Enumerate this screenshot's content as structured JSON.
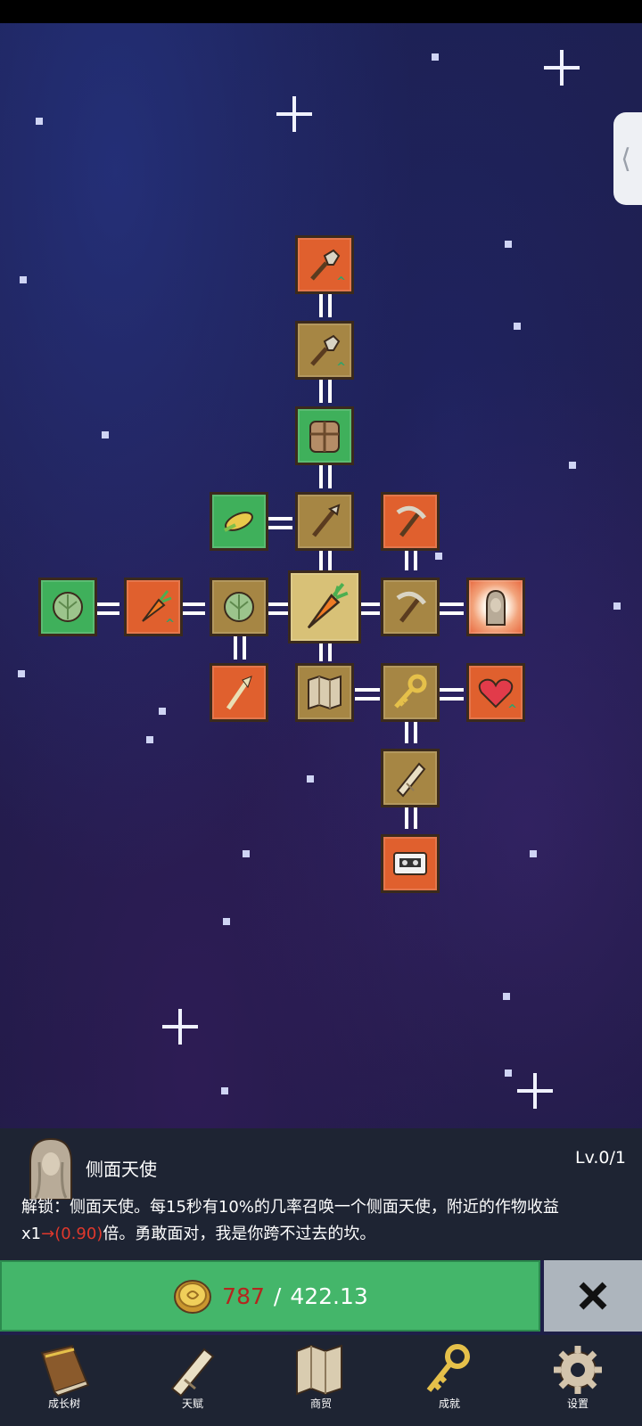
{
  "side_tab": {
    "glyph": "⟨"
  },
  "tree": {
    "nodes": [
      {
        "id": "shovel-upgrade",
        "icon": "shovel-icon",
        "color": "orange",
        "upgraded": true
      },
      {
        "id": "shovel",
        "icon": "shovel-icon",
        "color": "brown",
        "upgraded": true
      },
      {
        "id": "backpack",
        "icon": "backpack-icon",
        "color": "green",
        "upgraded": false
      },
      {
        "id": "corn",
        "icon": "corn-icon",
        "color": "green",
        "upgraded": false
      },
      {
        "id": "hoe",
        "icon": "hoe-icon",
        "color": "brown",
        "upgraded": false
      },
      {
        "id": "pickaxe-upgrade",
        "icon": "pickaxe-icon",
        "color": "orange",
        "upgraded": false
      },
      {
        "id": "cabbage-far",
        "icon": "cabbage-icon",
        "color": "green",
        "upgraded": false
      },
      {
        "id": "carrot-upgrade",
        "icon": "carrot-icon",
        "color": "orange",
        "upgraded": true
      },
      {
        "id": "cabbage",
        "icon": "cabbage-icon",
        "color": "brown",
        "upgraded": false
      },
      {
        "id": "carrot-root",
        "icon": "carrot-icon",
        "color": "center",
        "upgraded": false
      },
      {
        "id": "pickaxe",
        "icon": "pickaxe-icon",
        "color": "brown",
        "upgraded": false
      },
      {
        "id": "side-angel",
        "icon": "angel-icon",
        "color": "selected",
        "upgraded": false
      },
      {
        "id": "wheat",
        "icon": "wheat-icon",
        "color": "orange",
        "upgraded": false
      },
      {
        "id": "map",
        "icon": "map-icon",
        "color": "brown",
        "upgraded": false
      },
      {
        "id": "key",
        "icon": "key-icon",
        "color": "brown",
        "upgraded": false
      },
      {
        "id": "heart",
        "icon": "heart-icon",
        "color": "orange",
        "upgraded": true
      },
      {
        "id": "scroll",
        "icon": "scroll-icon",
        "color": "brown",
        "upgraded": false
      },
      {
        "id": "cassette",
        "icon": "cassette-icon",
        "color": "orange",
        "upgraded": false
      }
    ],
    "upgrade_mark": "^"
  },
  "info": {
    "portrait_icon": "angel-icon",
    "title": "侧面天使",
    "level": "Lv.0/1",
    "desc_part1": "解锁：侧面天使。每15秒有10%的几率召唤一个侧面天使，附近的作物收益x1",
    "desc_arrow": "→",
    "desc_new_value": "(0.90)",
    "desc_part2": "倍。勇敢面对，我是你跨不过去的坎。"
  },
  "purchase": {
    "coin_icon": "gold-coin-icon",
    "current": "787",
    "separator": "/",
    "cost": "422.13"
  },
  "close_button": {
    "icon": "close-x-icon"
  },
  "nav": {
    "items": [
      {
        "label": "成长树",
        "icon": "book-icon"
      },
      {
        "label": "天赋",
        "icon": "scroll-icon"
      },
      {
        "label": "商贸",
        "icon": "map-icon"
      },
      {
        "label": "成就",
        "icon": "key-icon"
      },
      {
        "label": "设置",
        "icon": "gear-icon"
      }
    ]
  },
  "colors": {
    "orange_node": "#e0602e",
    "brown_node": "#a68644",
    "green_node": "#3fb05b",
    "buy_green": "#44b66a",
    "coin_red": "#b3261e",
    "panel_bg": "#1e2433"
  }
}
